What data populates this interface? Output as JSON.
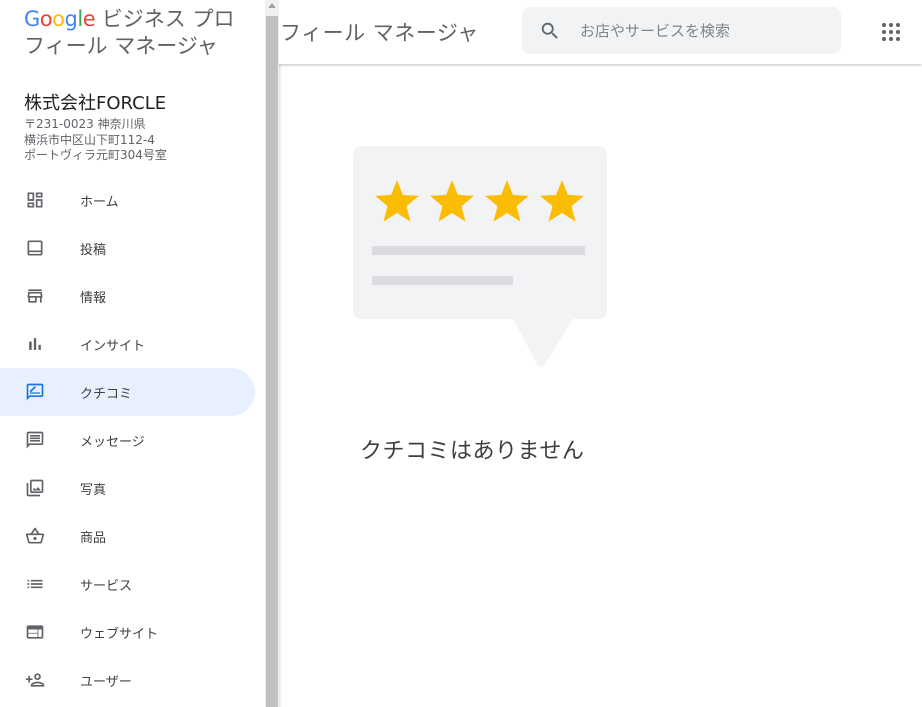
{
  "header": {
    "title": "フィール マネージャ",
    "search_placeholder": "お店やサービスを検索"
  },
  "brand": {
    "google": [
      "G",
      "o",
      "o",
      "g",
      "l",
      "e"
    ],
    "product_line1": "ビジネス プロ",
    "product_line2": "フィール マネージャ"
  },
  "business": {
    "name": "株式会社FORCLE",
    "address_lines": [
      "〒231-0023 神奈川県",
      "横浜市中区山下町112-4",
      "ポートヴィラ元町304号室"
    ]
  },
  "nav": {
    "items": [
      {
        "label": "ホーム",
        "icon": "dashboard-icon"
      },
      {
        "label": "投稿",
        "icon": "posts-icon"
      },
      {
        "label": "情報",
        "icon": "storefront-icon"
      },
      {
        "label": "インサイト",
        "icon": "bar-chart-icon"
      },
      {
        "label": "クチコミ",
        "icon": "rate-review-icon",
        "active": true
      },
      {
        "label": "メッセージ",
        "icon": "message-icon"
      },
      {
        "label": "写真",
        "icon": "photo-library-icon"
      },
      {
        "label": "商品",
        "icon": "basket-icon"
      },
      {
        "label": "サービス",
        "icon": "list-icon"
      },
      {
        "label": "ウェブサイト",
        "icon": "web-icon"
      },
      {
        "label": "ユーザー",
        "icon": "person-add-icon"
      }
    ]
  },
  "main": {
    "empty_message": "クチコミはありません",
    "illustration_stars": 4
  },
  "colors": {
    "accent": "#1a73e8",
    "active_bg": "#e8f0fe",
    "star": "#fbbc04",
    "card": "#f1f3f4",
    "line": "#dadce0"
  }
}
